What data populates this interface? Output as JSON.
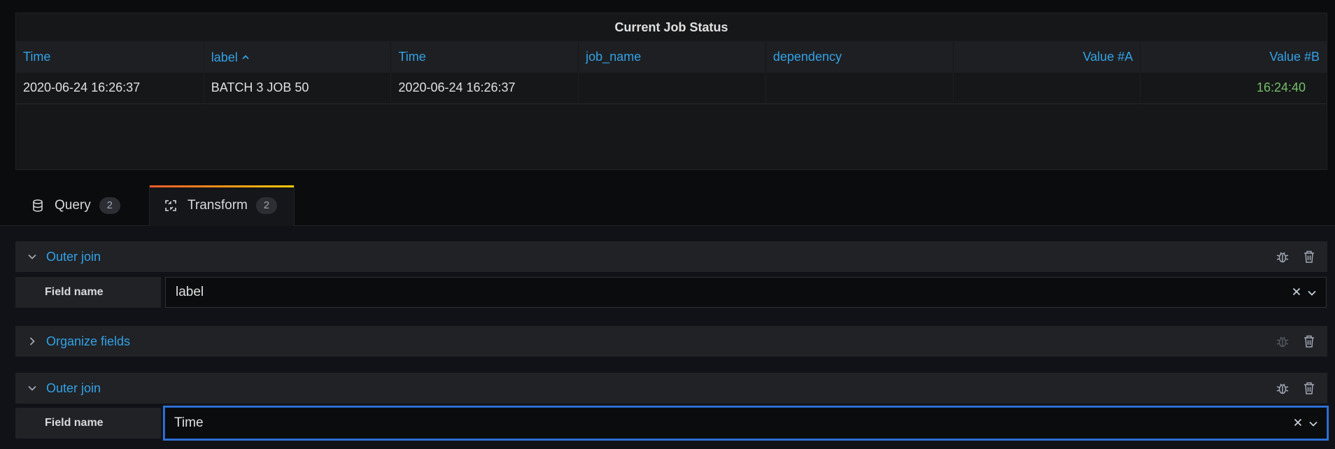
{
  "panel": {
    "title": "Current Job Status",
    "columns": [
      {
        "label": "Time",
        "align": "left",
        "width": 269
      },
      {
        "label": "label",
        "align": "left",
        "width": 268,
        "sorted": "asc"
      },
      {
        "label": "Time",
        "align": "left",
        "width": 268
      },
      {
        "label": "job_name",
        "align": "left",
        "width": 268
      },
      {
        "label": "dependency",
        "align": "left",
        "width": 268
      },
      {
        "label": "Value #A",
        "align": "right",
        "width": 268
      },
      {
        "label": "Value #B",
        "align": "right",
        "width": 266
      }
    ],
    "rows": [
      [
        "2020-06-24 16:26:37",
        "BATCH 3 JOB 50",
        "2020-06-24 16:26:37",
        "",
        "",
        "",
        "16:24:40"
      ]
    ]
  },
  "tabs": [
    {
      "label": "Query",
      "count": "2",
      "icon": "database-icon"
    },
    {
      "label": "Transform",
      "count": "2",
      "icon": "transform-icon",
      "active": true
    }
  ],
  "transformations": [
    {
      "name": "Outer join",
      "expanded": true,
      "field_label": "Field name",
      "field_value": "label",
      "debug_enabled": true
    },
    {
      "name": "Organize fields",
      "expanded": false,
      "debug_enabled": false
    },
    {
      "name": "Outer join",
      "expanded": true,
      "field_label": "Field name",
      "field_value": "Time",
      "debug_enabled": true,
      "focused": true
    }
  ],
  "colors": {
    "accent_blue": "#33a2e5",
    "value_green": "#73bf69",
    "focus_blue": "#3274d9",
    "tab_gradient_start": "#f05a28",
    "tab_gradient_end": "#fbca0a"
  }
}
